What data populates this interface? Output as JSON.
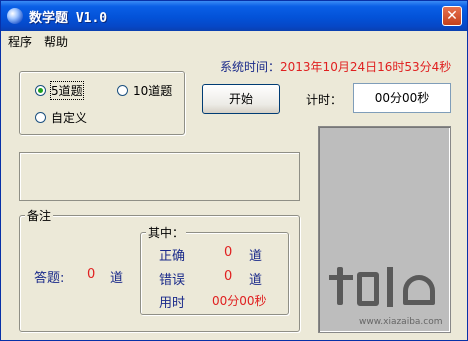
{
  "window": {
    "title": "数学题 V1.0",
    "close_label": "✕"
  },
  "menu": {
    "items": [
      "程序",
      "帮助"
    ]
  },
  "question_count": {
    "options": [
      "5道题",
      "10道题",
      "自定义"
    ],
    "selected": "5道题"
  },
  "system_time": {
    "label": "系统时间：",
    "value": "2013年10月24日16时53分4秒"
  },
  "controls": {
    "start_label": "开始",
    "timer_label": "计时：",
    "timer_value": "00分00秒"
  },
  "notes": {
    "label": "备注",
    "answered_label": "答题:",
    "answered_value": "0",
    "answered_unit": "道",
    "breakdown": {
      "label": "其中：",
      "correct_label": "正确",
      "correct_value": "0",
      "correct_unit": "道",
      "wrong_label": "错误",
      "wrong_value": "0",
      "wrong_unit": "道",
      "time_label": "用时",
      "time_value": "00分00秒"
    }
  },
  "watermark": {
    "text": "www.xiazaiba.com"
  },
  "colors": {
    "titlebar": "#0352d8",
    "window_bg": "#ece9d8",
    "label_blue": "#1a2a8a",
    "value_red": "#e02020"
  }
}
